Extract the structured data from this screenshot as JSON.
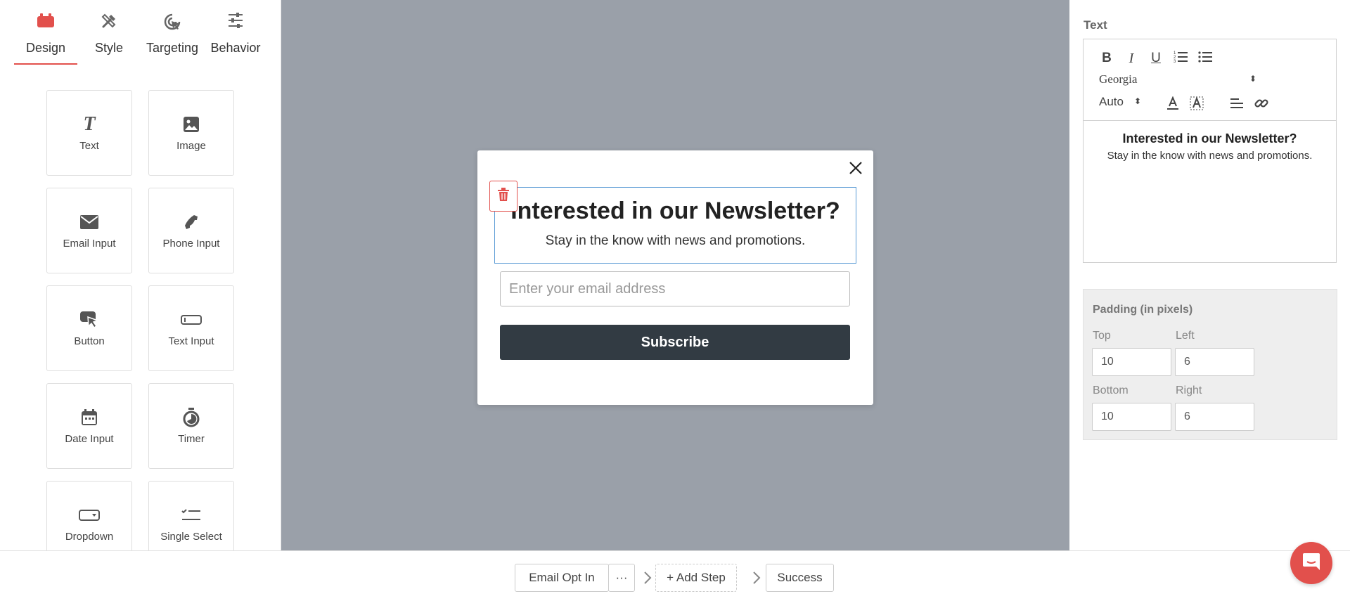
{
  "tabs": [
    {
      "label": "Design",
      "icon": "briefcase-icon",
      "active": true
    },
    {
      "label": "Style",
      "icon": "pen-ruler-icon"
    },
    {
      "label": "Targeting",
      "icon": "target-cursor-icon"
    },
    {
      "label": "Behavior",
      "icon": "sliders-icon"
    }
  ],
  "widgets": [
    {
      "label": "Text",
      "icon": "text-icon"
    },
    {
      "label": "Image",
      "icon": "image-icon"
    },
    {
      "label": "Email Input",
      "icon": "envelope-icon"
    },
    {
      "label": "Phone Input",
      "icon": "phone-icon"
    },
    {
      "label": "Button",
      "icon": "button-cursor-icon"
    },
    {
      "label": "Text Input",
      "icon": "text-field-icon"
    },
    {
      "label": "Date Input",
      "icon": "calendar-icon"
    },
    {
      "label": "Timer",
      "icon": "stopwatch-icon"
    },
    {
      "label": "Dropdown",
      "icon": "dropdown-icon"
    },
    {
      "label": "Single Select",
      "icon": "checklist-icon"
    }
  ],
  "modal": {
    "headline": "Interested in our Newsletter?",
    "subline": "Stay in the know with news and promotions.",
    "email_placeholder": "Enter your email address",
    "button_label": "Subscribe"
  },
  "panel": {
    "title": "Text",
    "font": "Georgia",
    "size": "Auto",
    "preview_headline": "Interested in our Newsletter?",
    "preview_subline": "Stay in the know with news and promotions."
  },
  "padding": {
    "title": "Padding (in pixels)",
    "top_label": "Top",
    "top": "10",
    "left_label": "Left",
    "left": "6",
    "bottom_label": "Bottom",
    "bottom": "10",
    "right_label": "Right",
    "right": "6"
  },
  "steps": {
    "step1": "Email Opt In",
    "more": "···",
    "add": "+ Add Step",
    "success": "Success"
  },
  "colors": {
    "accent": "#e2504c",
    "canvas": "#9aa0a9",
    "button": "#323b43"
  }
}
